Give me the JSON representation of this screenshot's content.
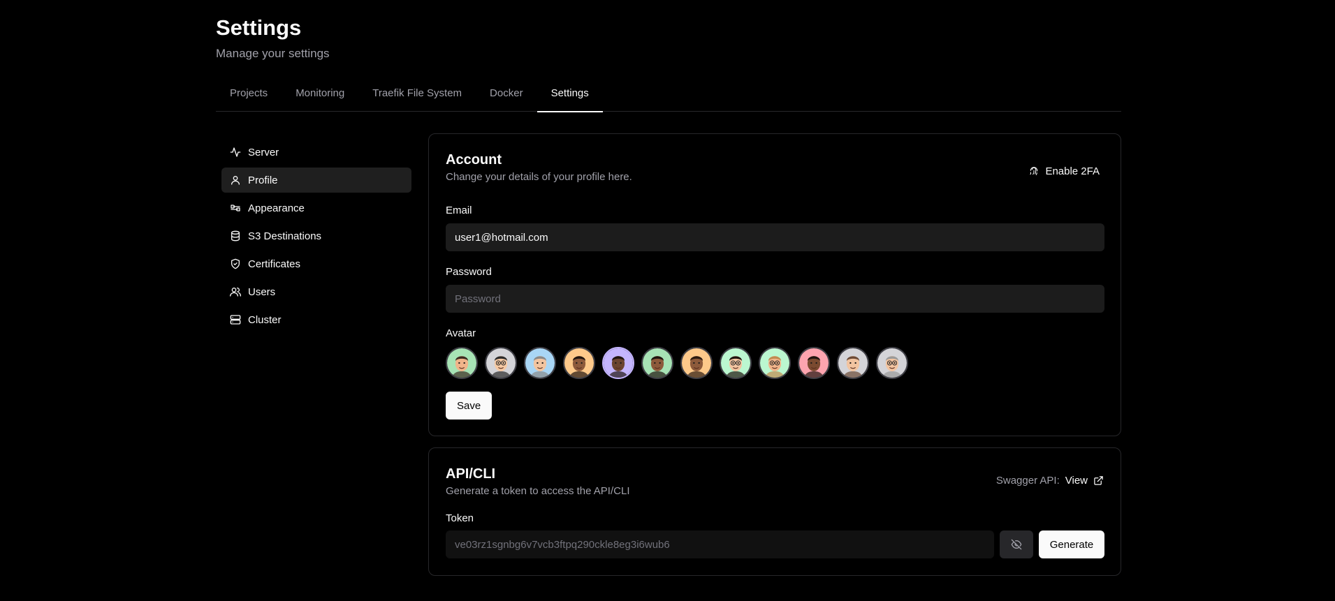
{
  "header": {
    "title": "Settings",
    "subtitle": "Manage your settings"
  },
  "tabs": [
    {
      "label": "Projects",
      "active": false
    },
    {
      "label": "Monitoring",
      "active": false
    },
    {
      "label": "Traefik File System",
      "active": false
    },
    {
      "label": "Docker",
      "active": false
    },
    {
      "label": "Settings",
      "active": true
    }
  ],
  "sidebar": {
    "items": [
      {
        "label": "Server",
        "icon": "activity-icon",
        "active": false
      },
      {
        "label": "Profile",
        "icon": "user-icon",
        "active": true
      },
      {
        "label": "Appearance",
        "icon": "palette-icon",
        "active": false
      },
      {
        "label": "S3 Destinations",
        "icon": "database-icon",
        "active": false
      },
      {
        "label": "Certificates",
        "icon": "shield-check-icon",
        "active": false
      },
      {
        "label": "Users",
        "icon": "users-icon",
        "active": false
      },
      {
        "label": "Cluster",
        "icon": "server-icon",
        "active": false
      }
    ]
  },
  "account": {
    "title": "Account",
    "description": "Change your details of your profile here.",
    "enable_2fa_label": "Enable 2FA",
    "email_label": "Email",
    "email_value": "user1@hotmail.com",
    "password_label": "Password",
    "password_placeholder": "Password",
    "avatar_label": "Avatar",
    "avatars": [
      {
        "bg": "#a7e3b5",
        "skin": "#f0b48a",
        "hair": "#3b2a20",
        "glasses": false,
        "selected": false
      },
      {
        "bg": "#d4d4d8",
        "skin": "#f5c9a3",
        "hair": "#2b2b2b",
        "glasses": true,
        "selected": false
      },
      {
        "bg": "#a9d6f5",
        "skin": "#f2c4a0",
        "hair": "#8a8a8a",
        "glasses": false,
        "selected": false
      },
      {
        "bg": "#fdc98a",
        "skin": "#8d5a3b",
        "hair": "#1f140e",
        "glasses": false,
        "selected": false
      },
      {
        "bg": "#c4b5fd",
        "skin": "#6b4430",
        "hair": "#1f140e",
        "glasses": false,
        "selected": true
      },
      {
        "bg": "#a7e3b5",
        "skin": "#8d5a3b",
        "hair": "#1f140e",
        "glasses": false,
        "selected": false
      },
      {
        "bg": "#fdc98a",
        "skin": "#8d5a3b",
        "hair": "#2b1a10",
        "glasses": false,
        "selected": false
      },
      {
        "bg": "#bbf7d0",
        "skin": "#f2c4a0",
        "hair": "#1f140e",
        "glasses": true,
        "selected": false
      },
      {
        "bg": "#bbf7d0",
        "skin": "#f0b48a",
        "hair": "#c08a50",
        "glasses": true,
        "selected": false
      },
      {
        "bg": "#fda4af",
        "skin": "#7a4a30",
        "hair": "#1f140e",
        "glasses": false,
        "selected": false
      },
      {
        "bg": "#d4d4d8",
        "skin": "#f2c4a0",
        "hair": "#6b4a36",
        "glasses": false,
        "selected": false
      },
      {
        "bg": "#d4d4d8",
        "skin": "#f2c4a0",
        "hair": "#9a9a9a",
        "glasses": true,
        "selected": false
      }
    ],
    "save_label": "Save"
  },
  "api": {
    "title": "API/CLI",
    "description": "Generate a token to access the API/CLI",
    "swagger_label": "Swagger API:",
    "swagger_link": "View",
    "token_label": "Token",
    "token_value": "ve03rz1sgnbg6v7vcb3ftpq290ckle8eg3i6wub6",
    "generate_label": "Generate"
  }
}
